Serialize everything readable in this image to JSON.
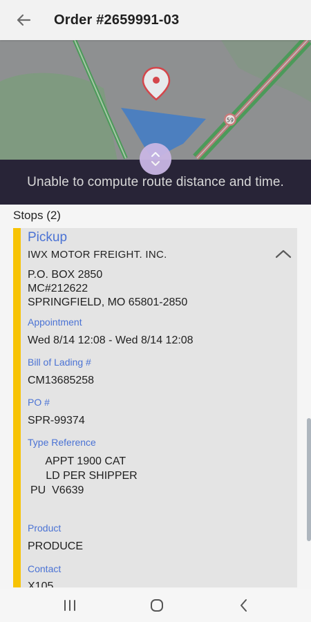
{
  "header": {
    "title": "Order #2659991-03"
  },
  "map": {
    "route_badge": "59",
    "banner": "Unable to compute route distance and time."
  },
  "stops": {
    "heading": "Stops (2)",
    "stop": {
      "type": "Pickup",
      "company": "IWX MOTOR FREIGHT. INC.",
      "address": [
        "P.O. BOX 2850",
        "MC#212622",
        "SPRINGFIELD, MO 65801-2850"
      ],
      "appointment_label": "Appointment",
      "appointment_value": "Wed 8/14 12:08 - Wed 8/14 12:08",
      "bol_label": "Bill of Lading #",
      "bol_value": "CM13685258",
      "po_label": "PO #",
      "po_value": "SPR-99374",
      "type_ref_label": "Type Reference",
      "type_ref_lines": [
        "     APPT 1900 CAT",
        "     LD PER SHIPPER",
        "PU  V6639"
      ],
      "product_label": "Product",
      "product_value": "PRODUCE",
      "contact_label": "Contact",
      "contact_value": "X105"
    }
  },
  "colors": {
    "accent": "#4a72d4",
    "stop_bar": "#f7c304",
    "banner_bg": "#282437"
  }
}
